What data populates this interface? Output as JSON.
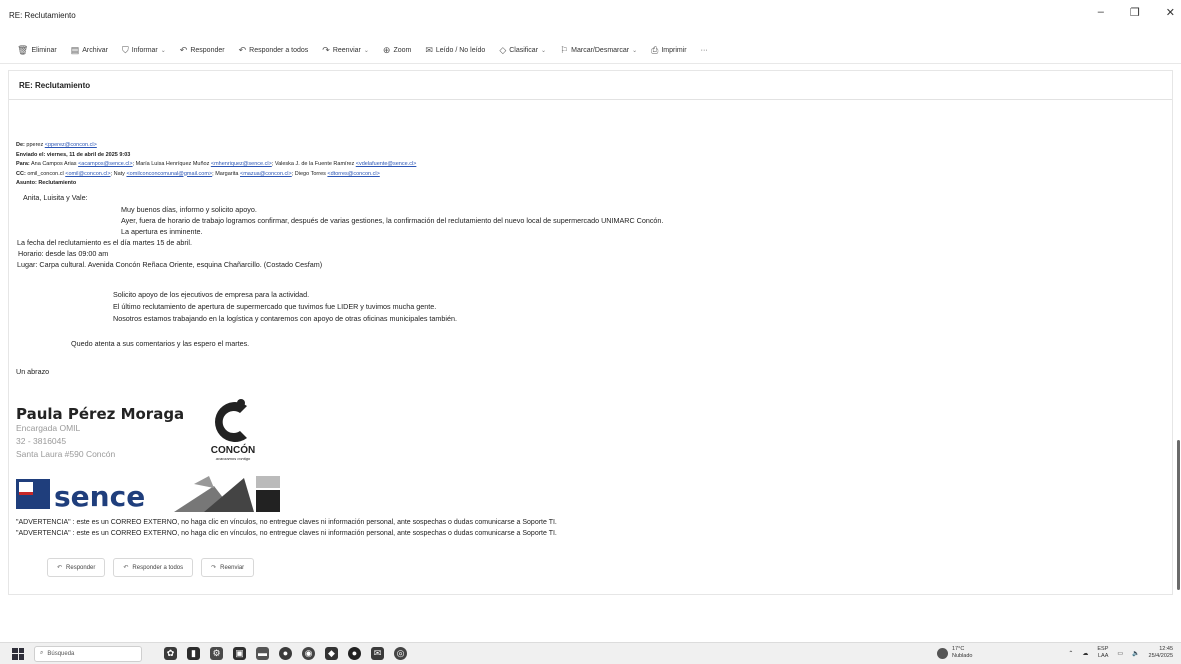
{
  "window": {
    "title": "RE: Reclutamiento",
    "controls": {
      "minimize": "–",
      "maximize": "❐",
      "close": "✕"
    }
  },
  "toolbar": {
    "items": [
      {
        "label": "Eliminar",
        "icon": "trash-icon"
      },
      {
        "label": "Archivar",
        "icon": "archive-icon"
      },
      {
        "label": "Informar",
        "icon": "shield-icon",
        "dropdown": true
      },
      {
        "label": "Responder",
        "icon": "reply-icon"
      },
      {
        "label": "Responder a todos",
        "icon": "reply-all-icon"
      },
      {
        "label": "Reenviar",
        "icon": "forward-icon",
        "dropdown": true
      },
      {
        "label": "Zoom",
        "icon": "zoom-icon"
      },
      {
        "label": "Leído / No leído",
        "icon": "envelope-open-icon"
      },
      {
        "label": "Clasificar",
        "icon": "tag-icon",
        "dropdown": true
      },
      {
        "label": "Marcar/Desmarcar",
        "icon": "flag-icon",
        "dropdown": true
      },
      {
        "label": "Imprimir",
        "icon": "printer-icon"
      },
      {
        "label": "···",
        "icon": ""
      }
    ]
  },
  "message": {
    "subject": "RE: Reclutamiento",
    "headers": {
      "from_label": "De:",
      "from_name": "pperez",
      "from_email": "<pperez@concon.cl>",
      "sent_label": "Enviado el:",
      "sent_value": "viernes, 11 de abril de 2025 9:03",
      "to_label": "Para:",
      "to_value_1": "Ana Campos Arias ",
      "to_email_1": "<acampos@sence.cl>",
      "to_value_2": "; María Luisa Henríquez Muñoz ",
      "to_email_2": "<mhenriquez@sence.cl>",
      "to_value_3": "; Valeska J. de la Fuente Ramírez ",
      "to_email_3": "<vdelafuente@sence.cl>",
      "cc_label": "CC:",
      "cc_value_1": "omil_concon.cl ",
      "cc_email_1": "<omil@concon.cl>",
      "cc_value_2": "; Naty ",
      "cc_email_2": "<omilconconcomunal@gmail.com>",
      "cc_value_3": "; Margarita ",
      "cc_email_3": "<mazua@concon.cl>",
      "cc_value_4": "; Diego Torres ",
      "cc_email_4": "<dtorres@concon.cl>",
      "subject_label": "Asunto:",
      "subject_value": "Reclutamiento"
    },
    "body": {
      "greeting": "Anita, Luisita y Vale:",
      "l1": "Muy buenos días, informo y solicito apoyo.",
      "l2": "Ayer, fuera de horario de trabajo logramos confirmar, después de varias gestiones, la confirmación del reclutamiento del nuevo local de supermercado UNIMARC Concón.",
      "l3": "La apertura es inminente.",
      "l4": "La fecha del reclutamiento es el día martes 15 de abril.",
      "l5": "Horario: desde las 09:00 am",
      "l6": "Lugar: Carpa cultural. Avenida Concón Reñaca Oriente, esquina Chañarcillo. (Costado Cesfam)",
      "l7": "Solicito apoyo de los ejecutivos de empresa para la actividad.",
      "l8": "El último reclutamiento de apertura de supermercado que tuvimos fue LIDER y tuvimos mucha gente.",
      "l9": "Nosotros estamos trabajando en la logística y contaremos con apoyo de otras oficinas municipales también.",
      "l10": "Quedo atenta a sus comentarios y las espero el martes.",
      "closing": "Un abrazo"
    },
    "signature": {
      "name": "Paula Pérez Moraga",
      "role": "Encargada OMIL",
      "phone": "32 - 3816045",
      "address": "Santa Laura #590 Concón",
      "concon_logo_text": "CONCÓN",
      "concon_logo_tagline": "avanzamos contigo",
      "sence_logo_text": "sence"
    },
    "warnings": [
      "\"ADVERTENCIA\" : este es un CORREO EXTERNO, no haga clic en vínculos, no entregue claves ni información personal, ante sospechas o dudas comunicarse a Soporte TI.",
      "\"ADVERTENCIA\" : este es un CORREO EXTERNO, no haga clic en vínculos, no entregue claves ni información personal, ante sospechas o dudas comunicarse a Soporte TI."
    ],
    "reply_actions": {
      "reply": "Responder",
      "reply_all": "Responder a todos",
      "forward": "Reenviar"
    }
  },
  "taskbar": {
    "search_placeholder": "Búsqueda",
    "weather_temp": "17°C",
    "weather_desc": "Nublado",
    "lang_top": "ESP",
    "lang_bottom": "LAA",
    "time": "12:45",
    "date": "25/4/2025"
  }
}
